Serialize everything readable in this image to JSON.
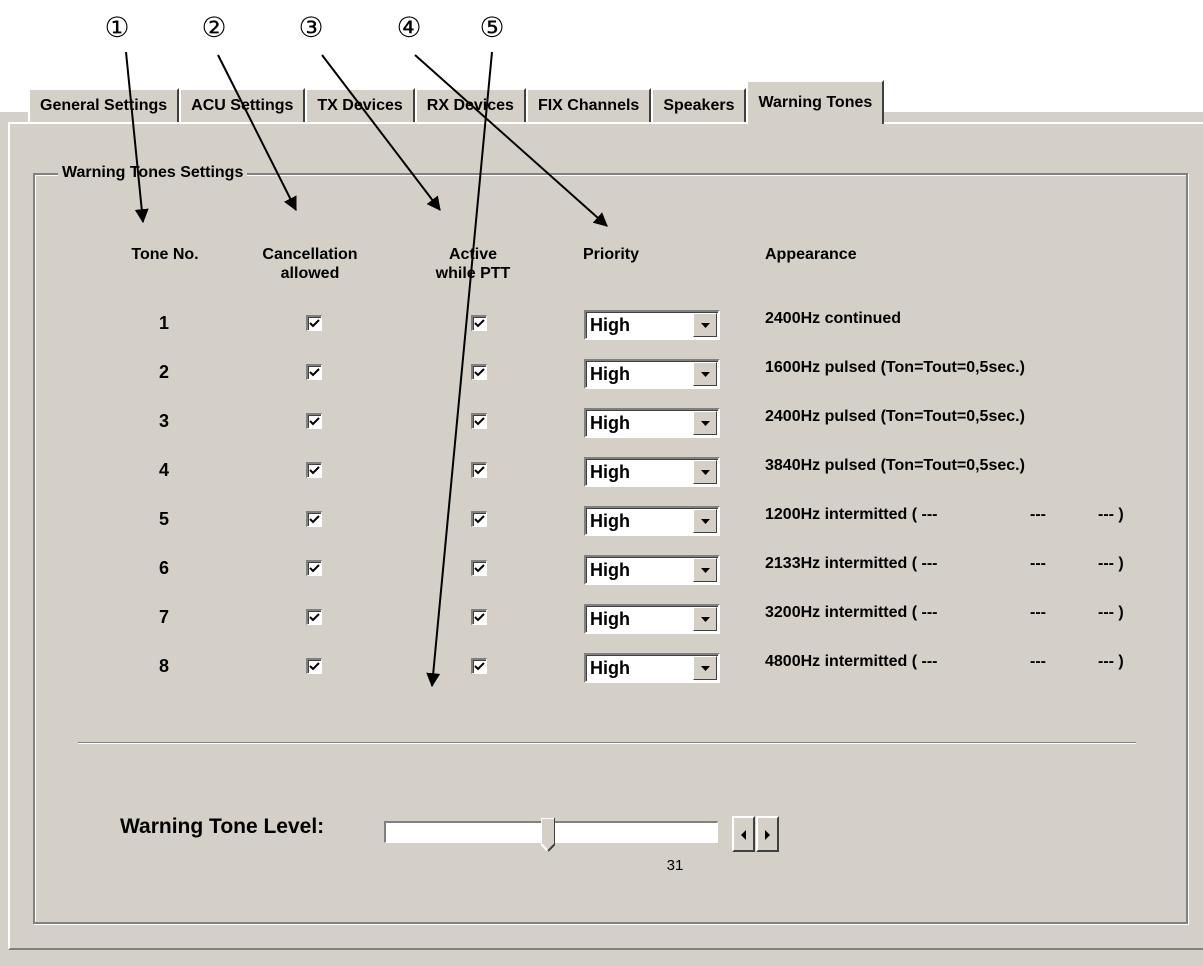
{
  "callouts": [
    "①",
    "②",
    "③",
    "④",
    "⑤"
  ],
  "tabs": [
    {
      "label": "General Settings",
      "active": false
    },
    {
      "label": "ACU Settings",
      "active": false
    },
    {
      "label": "TX Devices",
      "active": false
    },
    {
      "label": "RX Devices",
      "active": false
    },
    {
      "label": "FIX Channels",
      "active": false
    },
    {
      "label": "Speakers",
      "active": false
    },
    {
      "label": "Warning Tones",
      "active": true
    }
  ],
  "group_title": "Warning Tones Settings",
  "headers": {
    "tone_no": "Tone No.",
    "cancellation": "Cancellation\nallowed",
    "active_ptt": "Active\nwhile PTT",
    "priority": "Priority",
    "appearance": "Appearance"
  },
  "tones": [
    {
      "number": "1",
      "cancellation_allowed": true,
      "active_while_ptt": true,
      "priority": "High",
      "appearance": "2400Hz continued"
    },
    {
      "number": "2",
      "cancellation_allowed": true,
      "active_while_ptt": true,
      "priority": "High",
      "appearance": "1600Hz pulsed (Ton=Tout=0,5sec.)"
    },
    {
      "number": "3",
      "cancellation_allowed": true,
      "active_while_ptt": true,
      "priority": "High",
      "appearance": "2400Hz pulsed (Ton=Tout=0,5sec.)"
    },
    {
      "number": "4",
      "cancellation_allowed": true,
      "active_while_ptt": true,
      "priority": "High",
      "appearance": "3840Hz pulsed (Ton=Tout=0,5sec.)"
    },
    {
      "number": "5",
      "cancellation_allowed": true,
      "active_while_ptt": true,
      "priority": "High",
      "appearance": "1200Hz intermitted ( ---",
      "dash_mid": "---",
      "dash_end": "--- )"
    },
    {
      "number": "6",
      "cancellation_allowed": true,
      "active_while_ptt": true,
      "priority": "High",
      "appearance": "2133Hz intermitted ( ---",
      "dash_mid": "---",
      "dash_end": "--- )"
    },
    {
      "number": "7",
      "cancellation_allowed": true,
      "active_while_ptt": true,
      "priority": "High",
      "appearance": "3200Hz intermitted ( ---",
      "dash_mid": "---",
      "dash_end": "--- )"
    },
    {
      "number": "8",
      "cancellation_allowed": true,
      "active_while_ptt": true,
      "priority": "High",
      "appearance": "4800Hz intermitted ( ---",
      "dash_mid": "---",
      "dash_end": "--- )"
    }
  ],
  "level": {
    "label": "Warning Tone Level:",
    "value": "31",
    "fraction": 0.49
  },
  "colors": {
    "dialog_bg": "#d4d0c8",
    "highlight": "#ffffff",
    "shadow": "#808080"
  }
}
